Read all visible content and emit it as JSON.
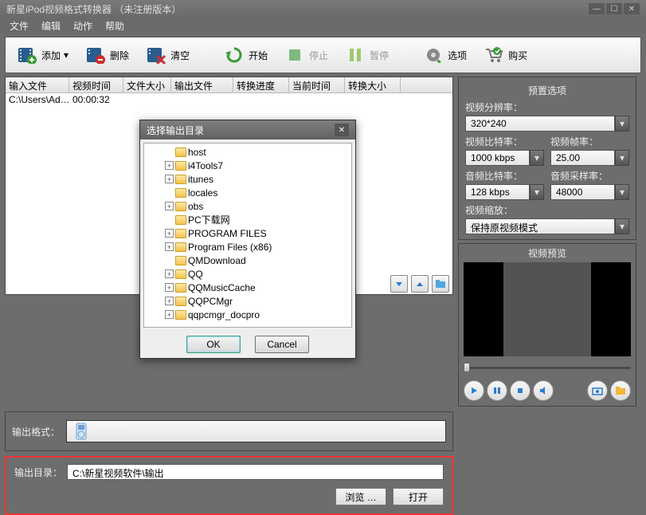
{
  "title": "新星iPod视频格式转换器 （未注册版本）",
  "menus": [
    "文件",
    "编辑",
    "动作",
    "帮助"
  ],
  "toolbar": {
    "add": "添加",
    "del": "删除",
    "clear": "清空",
    "start": "开始",
    "stop": "停止",
    "pause": "暂停",
    "options": "选项",
    "buy": "购买"
  },
  "list": {
    "headers": [
      "输入文件",
      "视频时间",
      "文件大小",
      "输出文件",
      "转换进度",
      "当前时间",
      "转换大小"
    ],
    "widths": [
      80,
      68,
      60,
      78,
      70,
      70,
      70
    ],
    "rows": [
      {
        "cells": [
          "C:\\Users\\Ad…",
          "00:00:32",
          "",
          "",
          "",
          "",
          ""
        ]
      }
    ]
  },
  "settings": {
    "title": "预置选项",
    "resolution_lbl": "视频分辨率：",
    "resolution": "320*240",
    "vbitrate_lbl": "视频比特率：",
    "vbitrate": "1000 kbps",
    "fps_lbl": "视频帧率：",
    "fps": "25.00",
    "abitrate_lbl": "音频比特率：",
    "abitrate": "128 kbps",
    "asample_lbl": "音频采样率：",
    "asample": "48000",
    "zoom_lbl": "视频缩放：",
    "zoom": "保持原视频模式"
  },
  "preview": {
    "title": "视频预览"
  },
  "outfmt": {
    "label": "输出格式：",
    "value_prefix": "iPod视",
    "value_suffix": "ap4）"
  },
  "outdir": {
    "label": "输出目录：",
    "value": "C:\\新星视频软件\\输出",
    "browse": "浏览 …",
    "open": "打开"
  },
  "dialog": {
    "title": "选择输出目录",
    "ok": "OK",
    "cancel": "Cancel",
    "nodes": [
      {
        "exp": false,
        "label": "host"
      },
      {
        "exp": true,
        "label": "i4Tools7"
      },
      {
        "exp": true,
        "label": "itunes"
      },
      {
        "exp": false,
        "label": "locales"
      },
      {
        "exp": true,
        "label": "obs"
      },
      {
        "exp": false,
        "label": "PC下载网"
      },
      {
        "exp": true,
        "label": "PROGRAM FILES"
      },
      {
        "exp": true,
        "label": "Program Files (x86)"
      },
      {
        "exp": false,
        "label": "QMDownload"
      },
      {
        "exp": true,
        "label": "QQ"
      },
      {
        "exp": true,
        "label": "QQMusicCache"
      },
      {
        "exp": true,
        "label": "QQPCMgr"
      },
      {
        "exp": true,
        "label": "qqpcmgr_docpro"
      }
    ]
  }
}
